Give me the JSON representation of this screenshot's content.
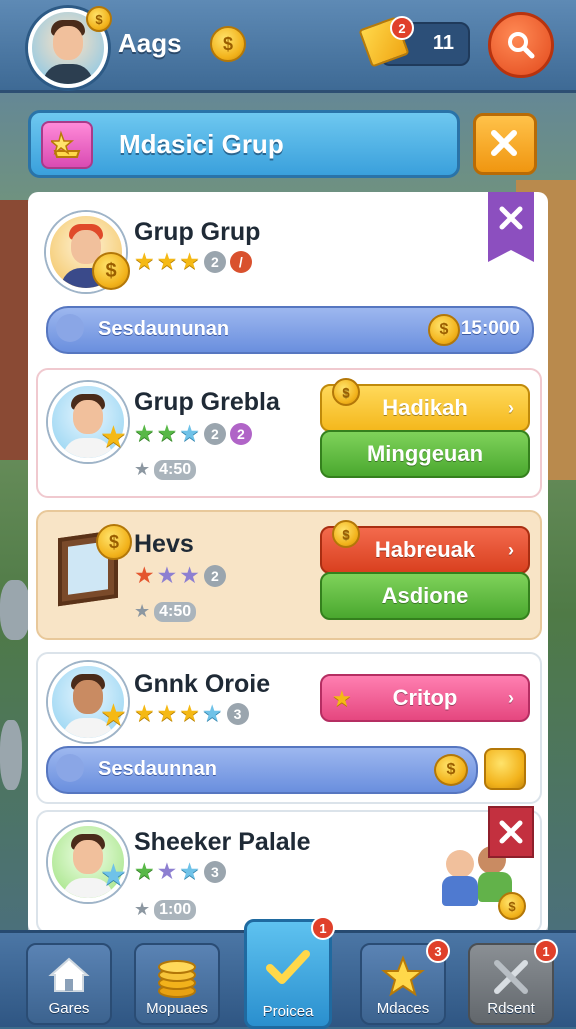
{
  "header": {
    "player_name": "Aags",
    "counter_value": "11",
    "ticket_badge": "2",
    "title": "Mdasici Grup"
  },
  "top_card": {
    "name": "Grup Grup",
    "level": "2",
    "badge": "/",
    "bar_label": "Sesdaununan",
    "bar_amount": "15:000"
  },
  "items": [
    {
      "name": "Grup Grebla",
      "level": "2",
      "badge": "2",
      "timer": "4:50",
      "btn1": "Hadikah",
      "btn2": "Minggeuan"
    },
    {
      "name": "Hevs",
      "level": "2",
      "timer": "4:50",
      "btn1": "Habreuak",
      "btn2": "Asdione"
    },
    {
      "name": "Gnnk Oroie",
      "level": "3",
      "btn1": "Critop",
      "bar_label": "Sesdaunnan"
    },
    {
      "name": "Sheeker Palale",
      "level": "3",
      "timer": "1:00"
    }
  ],
  "nav": [
    {
      "label": "Gares",
      "badge": ""
    },
    {
      "label": "Mopuaes",
      "badge": ""
    },
    {
      "label": "Proicea",
      "badge": "1"
    },
    {
      "label": "Mdaces",
      "badge": "3"
    },
    {
      "label": "Rdsent",
      "badge": "1"
    }
  ],
  "colors": {
    "accent": "#3aa0dc",
    "coin": "#f2b21b",
    "panel": "#ffffff",
    "nav": "#2f5683"
  },
  "icons": [
    "coin-icon",
    "ticket-icon",
    "search-icon",
    "trophy-icon",
    "close-icon",
    "star-icon",
    "home-icon",
    "coins-stack-icon",
    "check-icon",
    "sword-icon"
  ]
}
